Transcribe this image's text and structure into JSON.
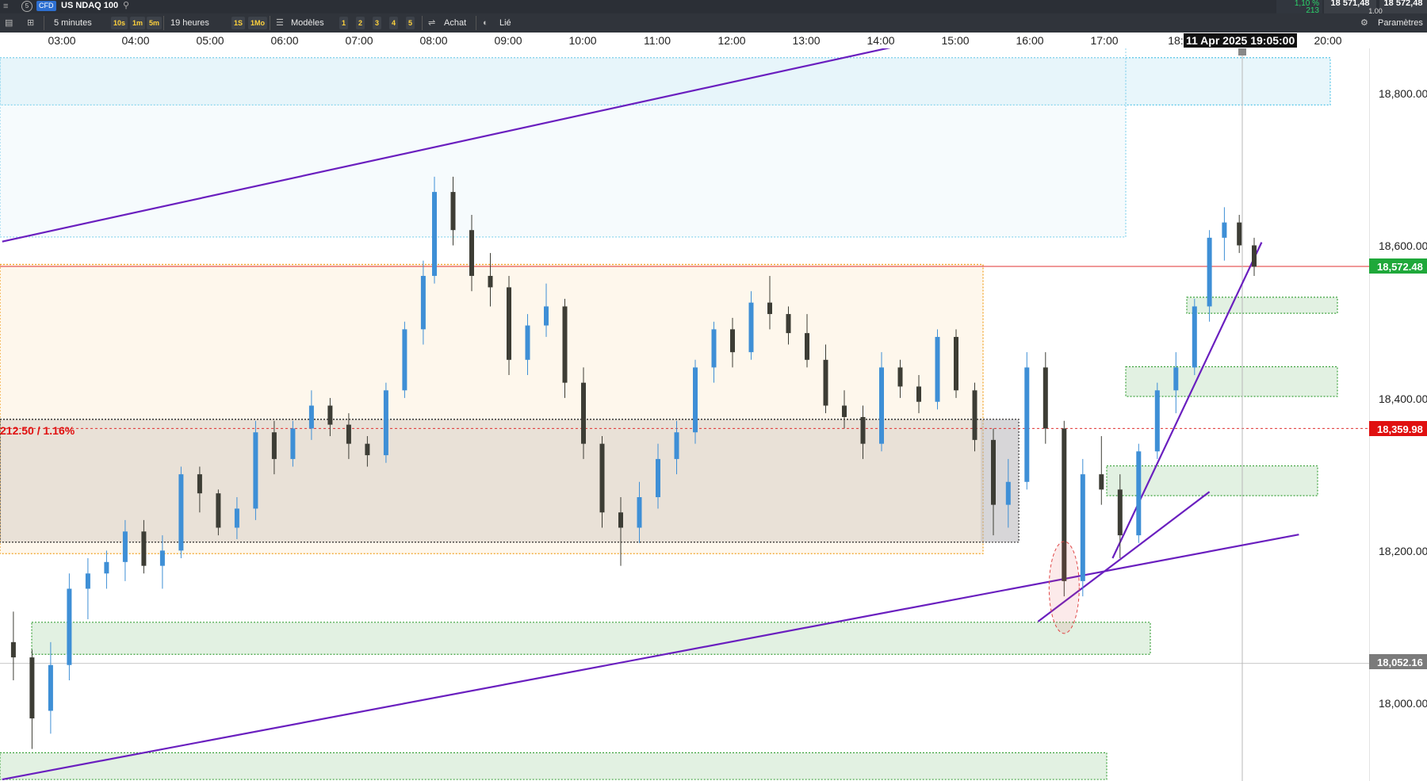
{
  "topbar": {
    "cfd_badge": "CFD",
    "instrument": "US NDAQ 100",
    "change_pct": "1,10 %",
    "change_count": "213",
    "bid": "18 571,48",
    "ask": "18 572,48",
    "spread": "1,00",
    "colors": {
      "up": "#2bd36a",
      "bg": "#2b2f36"
    }
  },
  "toolbar": {
    "timeframe": "5 minutes",
    "quick_frames": [
      "10s",
      "1m",
      "5m"
    ],
    "period": "19 heures",
    "quick_periods": [
      "1S",
      "1Mo"
    ],
    "models_label": "Modèles",
    "layouts": [
      "1",
      "2",
      "3",
      "4",
      "5"
    ],
    "buy_label": "Achat",
    "linked_label": "Lié",
    "settings_label": "Paramètres"
  },
  "time_axis": {
    "labels": [
      "03:00",
      "04:00",
      "05:00",
      "06:00",
      "07:00",
      "08:00",
      "09:00",
      "10:00",
      "11:00",
      "12:00",
      "13:00",
      "14:00",
      "15:00",
      "16:00",
      "17:00",
      "18:",
      "20:00"
    ],
    "crosshair_label": "11 Apr 2025 19:05:00"
  },
  "price_axis": {
    "labels": [
      "18,800.00",
      "18,600.00",
      "18,400.00",
      "18,200.00",
      "18,000.00"
    ],
    "current_price": "18,572.48",
    "ref_price": "18,359.98",
    "cursor_price": "18,052.16",
    "colors": {
      "current": "#1fa83a",
      "ref": "#e01010",
      "cursor": "#7b7b7b"
    }
  },
  "annotation": {
    "range_text": "212.50 / 1.16%",
    "color": "#e01010"
  },
  "chart_data": {
    "type": "candlestick",
    "interval": "5 minutes",
    "date": "11 Apr 2025",
    "y_range": [
      17920,
      18960
    ],
    "x_range_hours": [
      2.3,
      20.7
    ],
    "current_price": 18572.48,
    "reference_price": 18359.98,
    "cursor_price": 18052.16,
    "colors": {
      "up": "#3e8fd6",
      "down": "#3d3d35",
      "trendline": "#6a1fbf",
      "current_line": "#e03030"
    },
    "zones": [
      {
        "kind": "blue",
        "price_top": 18846,
        "price_bottom": 18784
      },
      {
        "kind": "blue-area",
        "price_top": 18846,
        "price_bottom": 18611
      },
      {
        "kind": "orange",
        "price_top": 18575,
        "price_bottom": 18196
      },
      {
        "kind": "range",
        "price_top": 18372,
        "price_bottom": 18211
      },
      {
        "kind": "green",
        "price_top": 18532,
        "price_bottom": 18511
      },
      {
        "kind": "green",
        "price_top": 18441,
        "price_bottom": 18402
      },
      {
        "kind": "green",
        "price_top": 18311,
        "price_bottom": 18272
      },
      {
        "kind": "green",
        "price_top": 18106,
        "price_bottom": 18064
      },
      {
        "kind": "green",
        "price_top": 17935,
        "price_bottom": 17900
      }
    ],
    "trendlines": [
      {
        "from": [
          2.2,
          18605
        ],
        "to": [
          18.7,
          18957
        ]
      },
      {
        "from": [
          2.2,
          17900
        ],
        "to": [
          19.6,
          18221
        ]
      },
      {
        "from": [
          16.1,
          18107
        ],
        "to": [
          18.4,
          18277
        ]
      },
      {
        "from": [
          17.1,
          18190
        ],
        "to": [
          19.1,
          18604
        ]
      }
    ],
    "candles": [
      {
        "t": 2.35,
        "o": 18080,
        "h": 18120,
        "l": 18030,
        "c": 18060
      },
      {
        "t": 2.6,
        "o": 18060,
        "h": 18070,
        "l": 17940,
        "c": 17980
      },
      {
        "t": 2.85,
        "o": 17990,
        "h": 18080,
        "l": 17960,
        "c": 18050
      },
      {
        "t": 3.1,
        "o": 18050,
        "h": 18170,
        "l": 18030,
        "c": 18150
      },
      {
        "t": 3.35,
        "o": 18150,
        "h": 18190,
        "l": 18110,
        "c": 18170
      },
      {
        "t": 3.6,
        "o": 18170,
        "h": 18200,
        "l": 18150,
        "c": 18185
      },
      {
        "t": 3.85,
        "o": 18185,
        "h": 18240,
        "l": 18160,
        "c": 18225
      },
      {
        "t": 4.1,
        "o": 18225,
        "h": 18240,
        "l": 18170,
        "c": 18180
      },
      {
        "t": 4.35,
        "o": 18180,
        "h": 18220,
        "l": 18150,
        "c": 18200
      },
      {
        "t": 4.6,
        "o": 18200,
        "h": 18310,
        "l": 18190,
        "c": 18300
      },
      {
        "t": 4.85,
        "o": 18300,
        "h": 18310,
        "l": 18250,
        "c": 18275
      },
      {
        "t": 5.1,
        "o": 18275,
        "h": 18280,
        "l": 18220,
        "c": 18230
      },
      {
        "t": 5.35,
        "o": 18230,
        "h": 18270,
        "l": 18215,
        "c": 18255
      },
      {
        "t": 5.6,
        "o": 18255,
        "h": 18370,
        "l": 18240,
        "c": 18355
      },
      {
        "t": 5.85,
        "o": 18355,
        "h": 18370,
        "l": 18300,
        "c": 18320
      },
      {
        "t": 6.1,
        "o": 18320,
        "h": 18370,
        "l": 18310,
        "c": 18360
      },
      {
        "t": 6.35,
        "o": 18360,
        "h": 18410,
        "l": 18345,
        "c": 18390
      },
      {
        "t": 6.6,
        "o": 18390,
        "h": 18400,
        "l": 18350,
        "c": 18365
      },
      {
        "t": 6.85,
        "o": 18365,
        "h": 18380,
        "l": 18320,
        "c": 18340
      },
      {
        "t": 7.1,
        "o": 18340,
        "h": 18350,
        "l": 18310,
        "c": 18325
      },
      {
        "t": 7.35,
        "o": 18325,
        "h": 18420,
        "l": 18315,
        "c": 18410
      },
      {
        "t": 7.6,
        "o": 18410,
        "h": 18500,
        "l": 18400,
        "c": 18490
      },
      {
        "t": 7.85,
        "o": 18490,
        "h": 18580,
        "l": 18470,
        "c": 18560
      },
      {
        "t": 8.0,
        "o": 18560,
        "h": 18690,
        "l": 18550,
        "c": 18670
      },
      {
        "t": 8.25,
        "o": 18670,
        "h": 18690,
        "l": 18600,
        "c": 18620
      },
      {
        "t": 8.5,
        "o": 18620,
        "h": 18640,
        "l": 18540,
        "c": 18560
      },
      {
        "t": 8.75,
        "o": 18560,
        "h": 18590,
        "l": 18520,
        "c": 18545
      },
      {
        "t": 9.0,
        "o": 18545,
        "h": 18560,
        "l": 18430,
        "c": 18450
      },
      {
        "t": 9.25,
        "o": 18450,
        "h": 18510,
        "l": 18430,
        "c": 18495
      },
      {
        "t": 9.5,
        "o": 18495,
        "h": 18550,
        "l": 18480,
        "c": 18520
      },
      {
        "t": 9.75,
        "o": 18520,
        "h": 18530,
        "l": 18400,
        "c": 18420
      },
      {
        "t": 10.0,
        "o": 18420,
        "h": 18440,
        "l": 18320,
        "c": 18340
      },
      {
        "t": 10.25,
        "o": 18340,
        "h": 18350,
        "l": 18230,
        "c": 18250
      },
      {
        "t": 10.5,
        "o": 18250,
        "h": 18270,
        "l": 18180,
        "c": 18230
      },
      {
        "t": 10.75,
        "o": 18230,
        "h": 18290,
        "l": 18210,
        "c": 18270
      },
      {
        "t": 11.0,
        "o": 18270,
        "h": 18340,
        "l": 18255,
        "c": 18320
      },
      {
        "t": 11.25,
        "o": 18320,
        "h": 18370,
        "l": 18300,
        "c": 18355
      },
      {
        "t": 11.5,
        "o": 18355,
        "h": 18450,
        "l": 18340,
        "c": 18440
      },
      {
        "t": 11.75,
        "o": 18440,
        "h": 18500,
        "l": 18420,
        "c": 18490
      },
      {
        "t": 12.0,
        "o": 18490,
        "h": 18505,
        "l": 18440,
        "c": 18460
      },
      {
        "t": 12.25,
        "o": 18460,
        "h": 18540,
        "l": 18450,
        "c": 18525
      },
      {
        "t": 12.5,
        "o": 18525,
        "h": 18560,
        "l": 18490,
        "c": 18510
      },
      {
        "t": 12.75,
        "o": 18510,
        "h": 18520,
        "l": 18470,
        "c": 18485
      },
      {
        "t": 13.0,
        "o": 18485,
        "h": 18510,
        "l": 18440,
        "c": 18450
      },
      {
        "t": 13.25,
        "o": 18450,
        "h": 18470,
        "l": 18380,
        "c": 18390
      },
      {
        "t": 13.5,
        "o": 18390,
        "h": 18410,
        "l": 18360,
        "c": 18375
      },
      {
        "t": 13.75,
        "o": 18375,
        "h": 18390,
        "l": 18320,
        "c": 18340
      },
      {
        "t": 14.0,
        "o": 18340,
        "h": 18460,
        "l": 18330,
        "c": 18440
      },
      {
        "t": 14.25,
        "o": 18440,
        "h": 18450,
        "l": 18400,
        "c": 18415
      },
      {
        "t": 14.5,
        "o": 18415,
        "h": 18430,
        "l": 18380,
        "c": 18395
      },
      {
        "t": 14.75,
        "o": 18395,
        "h": 18490,
        "l": 18385,
        "c": 18480
      },
      {
        "t": 15.0,
        "o": 18480,
        "h": 18490,
        "l": 18400,
        "c": 18410
      },
      {
        "t": 15.25,
        "o": 18410,
        "h": 18420,
        "l": 18330,
        "c": 18345
      },
      {
        "t": 15.5,
        "o": 18345,
        "h": 18360,
        "l": 18220,
        "c": 18260
      },
      {
        "t": 15.7,
        "o": 18260,
        "h": 18320,
        "l": 18230,
        "c": 18290
      },
      {
        "t": 15.95,
        "o": 18290,
        "h": 18460,
        "l": 18280,
        "c": 18440
      },
      {
        "t": 16.2,
        "o": 18440,
        "h": 18460,
        "l": 18340,
        "c": 18360
      },
      {
        "t": 16.45,
        "o": 18360,
        "h": 18370,
        "l": 18140,
        "c": 18160
      },
      {
        "t": 16.7,
        "o": 18160,
        "h": 18320,
        "l": 18140,
        "c": 18300
      },
      {
        "t": 16.95,
        "o": 18300,
        "h": 18350,
        "l": 18260,
        "c": 18280
      },
      {
        "t": 17.2,
        "o": 18280,
        "h": 18300,
        "l": 18190,
        "c": 18220
      },
      {
        "t": 17.45,
        "o": 18220,
        "h": 18340,
        "l": 18210,
        "c": 18330
      },
      {
        "t": 17.7,
        "o": 18330,
        "h": 18420,
        "l": 18320,
        "c": 18410
      },
      {
        "t": 17.95,
        "o": 18410,
        "h": 18460,
        "l": 18380,
        "c": 18440
      },
      {
        "t": 18.2,
        "o": 18440,
        "h": 18530,
        "l": 18430,
        "c": 18520
      },
      {
        "t": 18.4,
        "o": 18520,
        "h": 18620,
        "l": 18500,
        "c": 18610
      },
      {
        "t": 18.6,
        "o": 18610,
        "h": 18650,
        "l": 18580,
        "c": 18630
      },
      {
        "t": 18.8,
        "o": 18630,
        "h": 18640,
        "l": 18590,
        "c": 18600
      },
      {
        "t": 19.0,
        "o": 18600,
        "h": 18610,
        "l": 18560,
        "c": 18572
      }
    ]
  }
}
